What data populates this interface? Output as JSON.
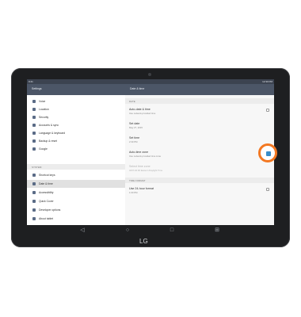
{
  "status_bar": {
    "time_left": "9:41",
    "time_right": "12:30 PM"
  },
  "app_bar": {
    "title": "Settings",
    "detail_title": "Date & time"
  },
  "sidebar": {
    "items_top": [
      {
        "label": "Voice",
        "icon": "mic-icon"
      },
      {
        "label": "Location",
        "icon": "location-icon"
      },
      {
        "label": "Security",
        "icon": "lock-icon"
      },
      {
        "label": "Accounts & sync",
        "icon": "account-icon"
      },
      {
        "label": "Language & keyboard",
        "icon": "keyboard-icon"
      },
      {
        "label": "Backup & reset",
        "icon": "backup-icon"
      },
      {
        "label": "Google",
        "icon": "google-icon"
      }
    ],
    "section_system": "SYSTEM",
    "items_system": [
      {
        "label": "Shortcut keys",
        "icon": "shortcut-icon"
      },
      {
        "label": "Date & time",
        "icon": "clock-icon"
      },
      {
        "label": "Accessibility",
        "icon": "accessibility-icon"
      },
      {
        "label": "Quick Cover",
        "icon": "cover-icon"
      },
      {
        "label": "Developer options",
        "icon": "developer-icon"
      },
      {
        "label": "About tablet",
        "icon": "info-icon"
      }
    ]
  },
  "detail": {
    "section_date": "DATE",
    "rows": [
      {
        "title": "Auto-date & time",
        "subtitle": "Use network-provided time",
        "checkbox": true
      },
      {
        "title": "Set date",
        "subtitle": "May 27, 2015",
        "checkbox": false
      },
      {
        "title": "Set time",
        "subtitle": "2:30 PM",
        "checkbox": false
      },
      {
        "title": "Auto-time zone",
        "subtitle": "Use network-provided time zone",
        "checkbox": true
      },
      {
        "title": "Select time zone",
        "subtitle": "GMT-04:00 Eastern Daylight Time",
        "checkbox": false
      }
    ],
    "section_time_format": "TIME FORMAT",
    "time_format_row": {
      "title": "Use 24-hour format",
      "subtitle": "1:00 PM",
      "checkbox": true
    }
  },
  "nav_bar": {
    "back": "◁",
    "home": "○",
    "recents": "□",
    "more": "⊞"
  },
  "brand": "LG",
  "colors": {
    "accent_highlight": "#f37822",
    "app_bar": "#4c5667"
  }
}
